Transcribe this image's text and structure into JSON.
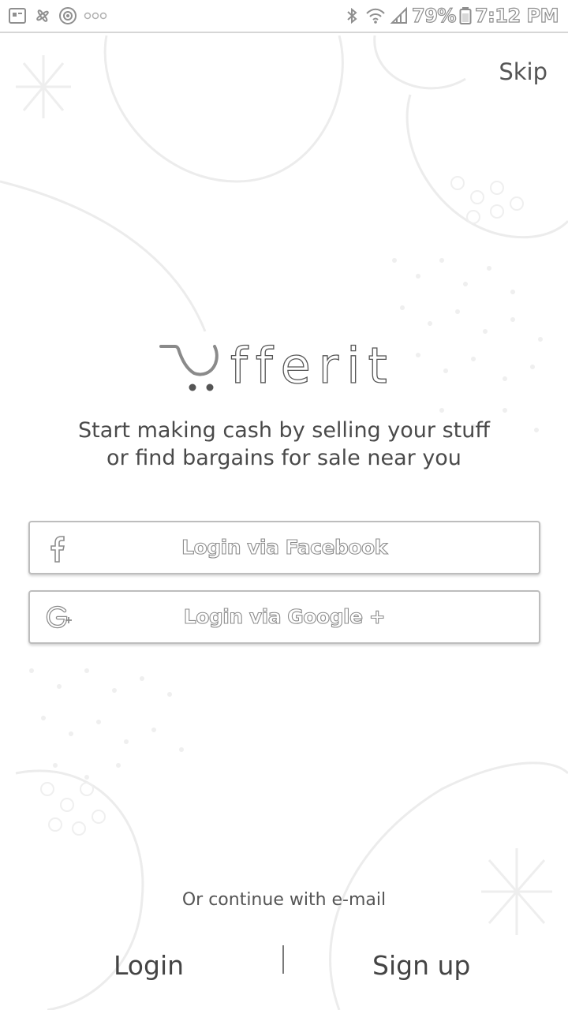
{
  "status_bar": {
    "battery": "79%",
    "time": "7:12 PM",
    "icons": [
      "notification-icon",
      "pinwheel-icon",
      "target-icon",
      "more-dots-icon",
      "bluetooth-icon",
      "wifi-icon",
      "signal-icon",
      "battery-icon"
    ]
  },
  "header": {
    "skip_label": "Skip"
  },
  "brand": {
    "logo_text": "fferit"
  },
  "tagline": {
    "line1": "Start making cash by selling your stuff",
    "line2": "or find bargains for sale near you"
  },
  "social": {
    "facebook_label": "Login via Facebook",
    "google_label": "Login via Google +"
  },
  "email": {
    "prompt": "Or continue with e-mail",
    "login_label": "Login",
    "signup_label": "Sign up"
  }
}
